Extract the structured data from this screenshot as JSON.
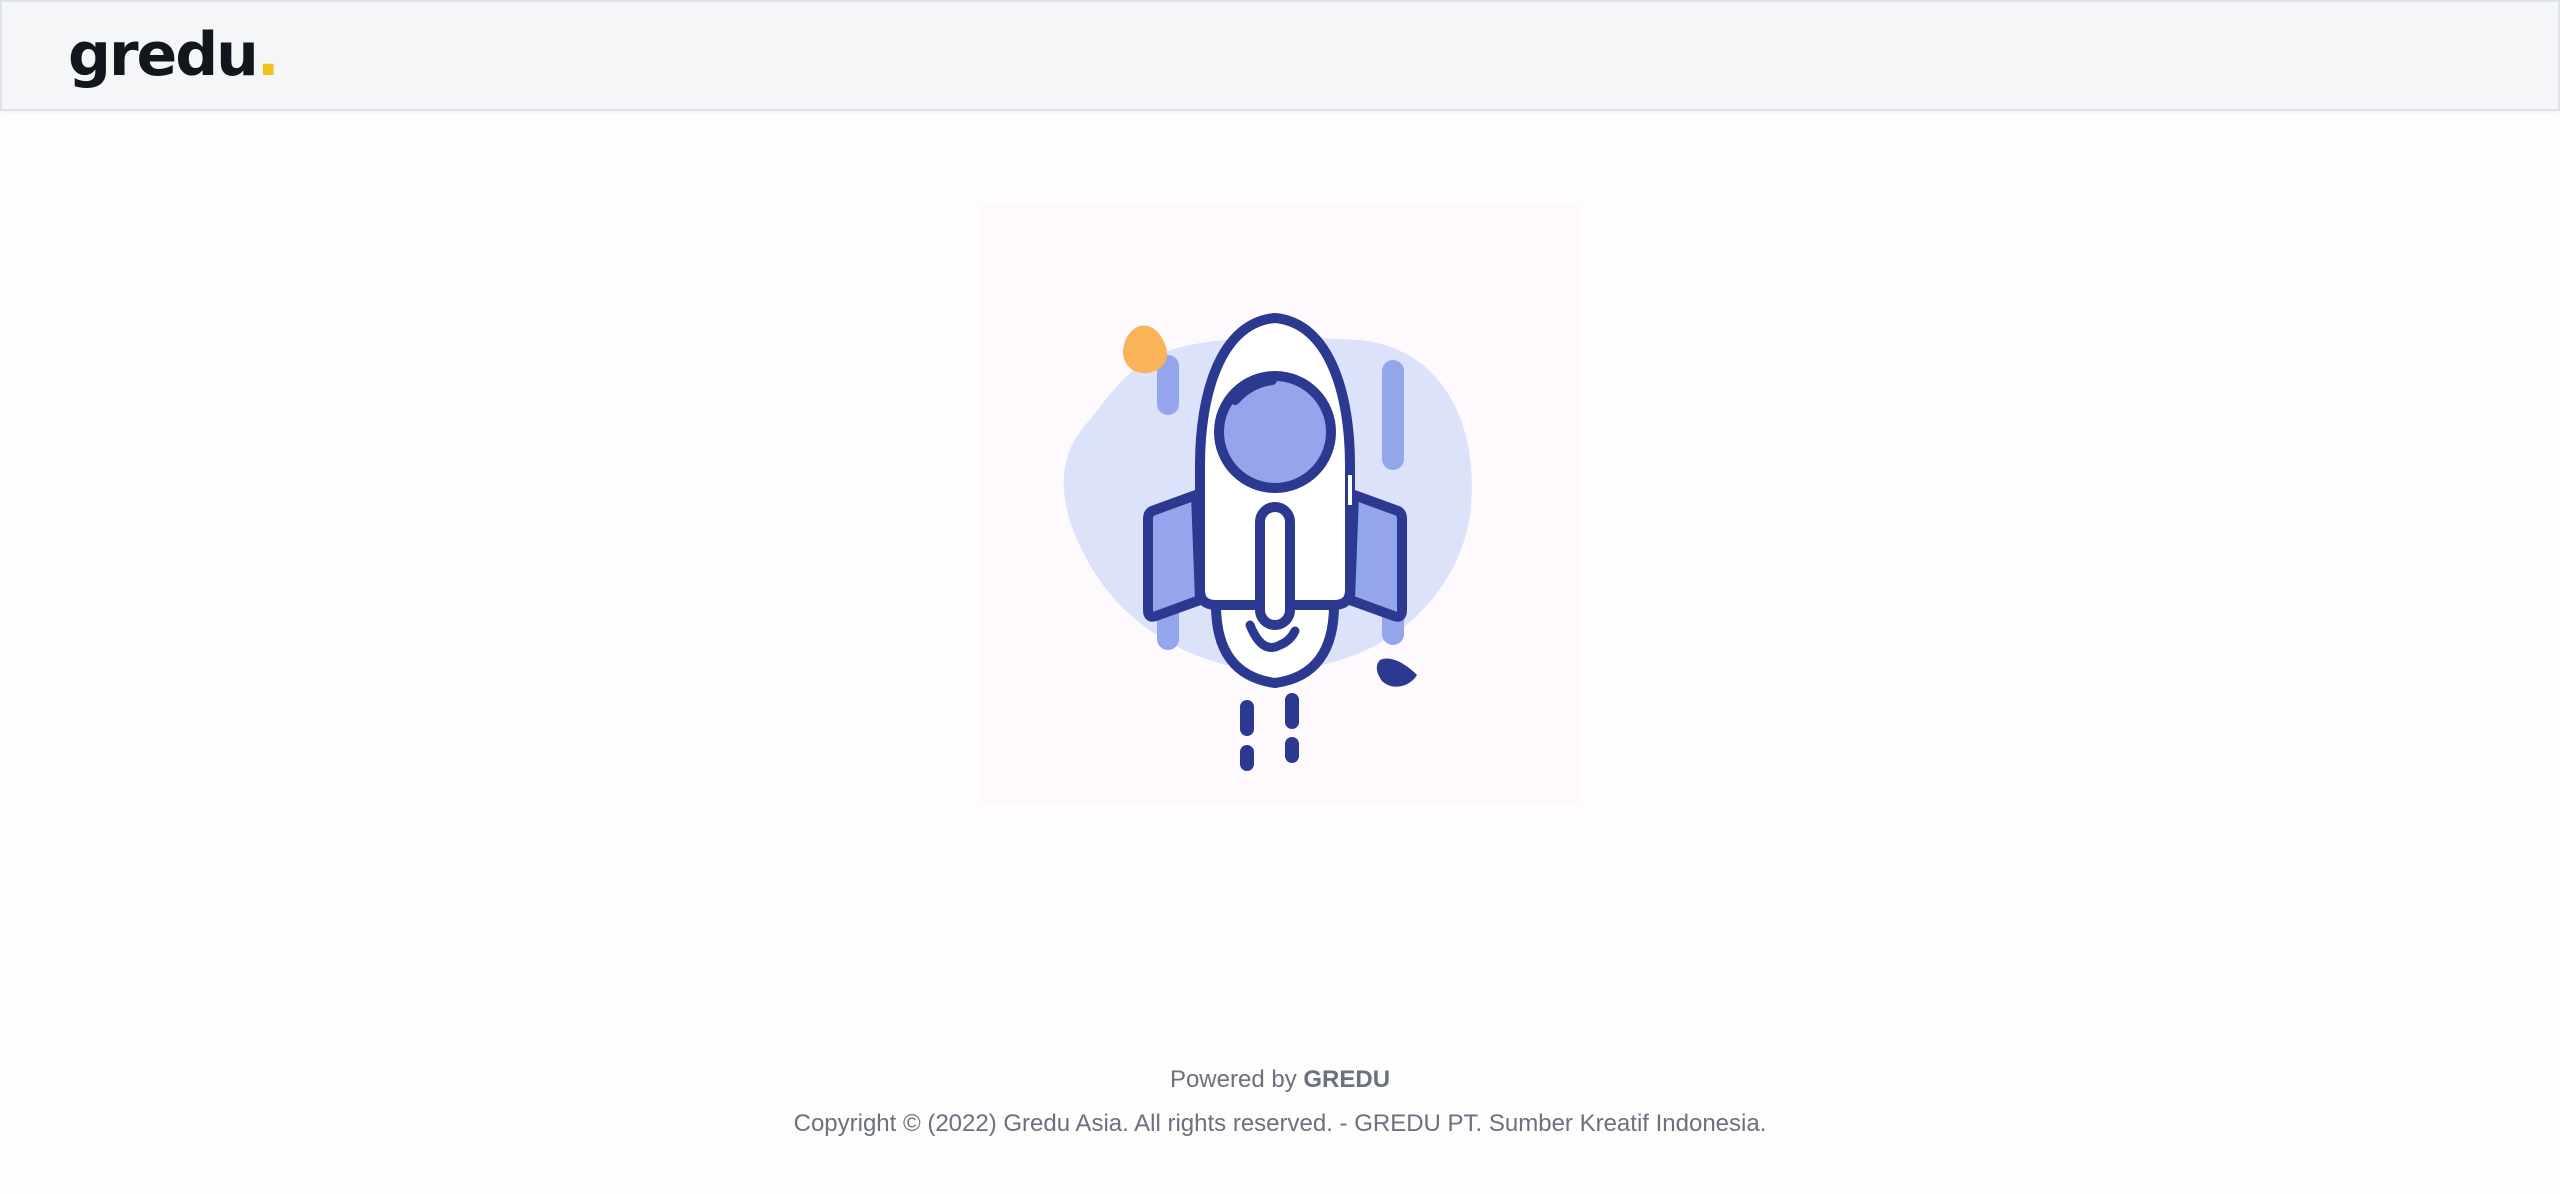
{
  "header": {
    "logo_text": "gredu",
    "logo_dot": ".",
    "logo_dot_color": "#f2c21a"
  },
  "illustration": {
    "name": "rocket-launch-illustration",
    "colors": {
      "outline": "#2b3990",
      "fill_light": "#dbe2fa",
      "fill_mid": "#93a6ec",
      "accent_orange": "#fbb35a"
    }
  },
  "footer": {
    "powered_prefix": "Powered by ",
    "powered_brand": "GREDU",
    "copyright": "Copyright © (2022) Gredu Asia. All rights reserved. - GREDU PT. Sumber Kreatif Indonesia."
  }
}
